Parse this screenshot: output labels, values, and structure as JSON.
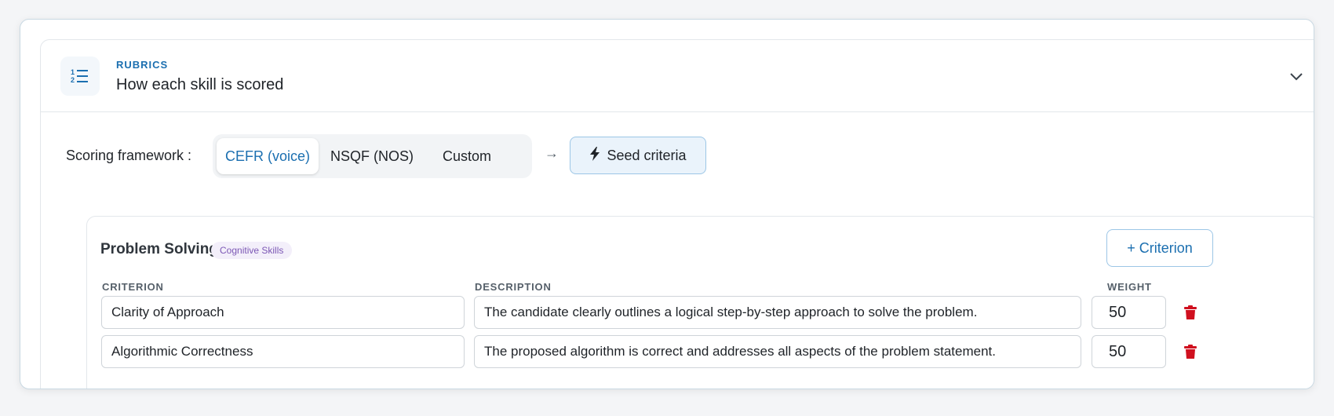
{
  "rubrics": {
    "eyebrow": "RUBRICS",
    "title": "How each skill is scored"
  },
  "framework": {
    "label": "Scoring framework :",
    "options": [
      "CEFR (voice)",
      "NSQF (NOS)",
      "Custom"
    ],
    "selected": "CEFR (voice)",
    "seed_label": "Seed criteria"
  },
  "skill": {
    "name": "Problem Solving",
    "category": "Cognitive Skills",
    "add_label": "+ Criterion",
    "columns": [
      "CRITERION",
      "DESCRIPTION",
      "WEIGHT"
    ],
    "rows": [
      {
        "criterion": "Clarity of Approach",
        "description": "The candidate clearly outlines a logical step-by-step approach to solve the problem.",
        "weight": "50"
      },
      {
        "criterion": "Algorithmic Correctness",
        "description": "The proposed algorithm is correct and addresses all aspects of the problem statement.",
        "weight": "50"
      }
    ]
  },
  "colors": {
    "accent": "#1b6fb0",
    "badge_text": "#7c58b5",
    "badge_bg": "#f3effa",
    "delete": "#d0101f"
  },
  "icons": {
    "header": "numbered-list-icon",
    "collapse": "chevron-down-icon",
    "seed": "lightning-icon",
    "delete": "trash-icon"
  }
}
